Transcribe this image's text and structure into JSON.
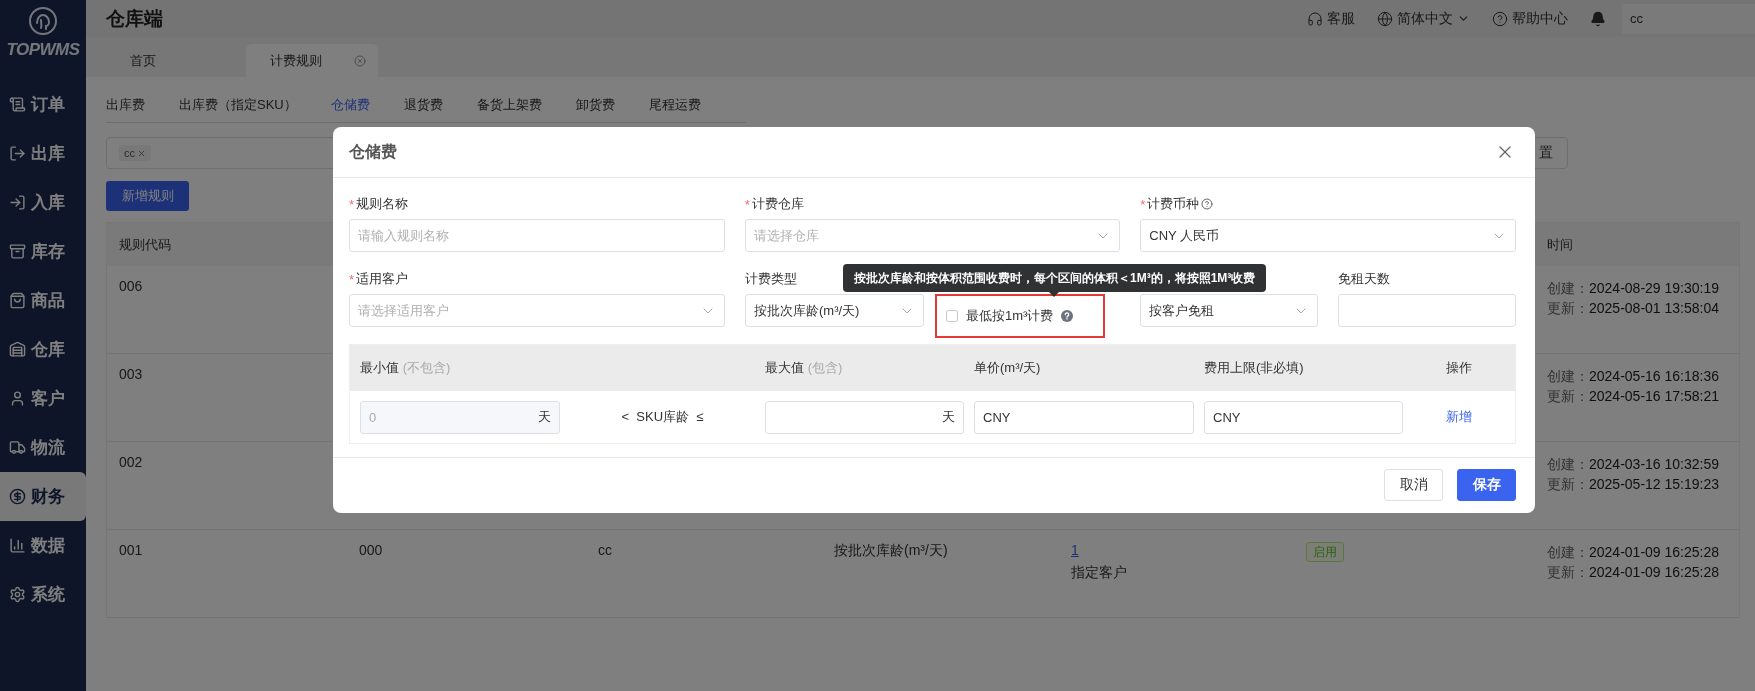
{
  "sidebar": {
    "logo": "TOPWMS",
    "items": [
      {
        "label": "订单",
        "selected": false
      },
      {
        "label": "出库",
        "selected": false
      },
      {
        "label": "入库",
        "selected": false
      },
      {
        "label": "库存",
        "selected": false
      },
      {
        "label": "商品",
        "selected": false
      },
      {
        "label": "仓库",
        "selected": false
      },
      {
        "label": "客户",
        "selected": false
      },
      {
        "label": "物流",
        "selected": false
      },
      {
        "label": "财务",
        "selected": true
      },
      {
        "label": "数据",
        "selected": false
      },
      {
        "label": "系统",
        "selected": false
      }
    ]
  },
  "header": {
    "title": "仓库端",
    "actions": [
      {
        "label": "客服",
        "dropdown": false
      },
      {
        "label": "简体中文",
        "dropdown": true
      },
      {
        "label": "帮助中心",
        "dropdown": false
      }
    ],
    "search": {
      "value": "cc"
    }
  },
  "page_tabs": [
    {
      "label": "首页",
      "selected": false,
      "closable": false
    },
    {
      "label": "计费规则",
      "selected": true,
      "closable": true
    }
  ],
  "fee_tabs": [
    {
      "label": "出库费",
      "selected": false
    },
    {
      "label": "出库费（指定SKU）",
      "selected": false
    },
    {
      "label": "仓储费",
      "selected": true
    },
    {
      "label": "退货费",
      "selected": false
    },
    {
      "label": "备货上架费",
      "selected": false
    },
    {
      "label": "卸货费",
      "selected": false
    },
    {
      "label": "尾程运费",
      "selected": false
    }
  ],
  "filter": {
    "tags": [
      "cc"
    ],
    "reset_button": "置"
  },
  "add_button": "新增规则",
  "table": {
    "header": {
      "column_1": "规则代码",
      "column_7": "时间"
    },
    "rows": [
      {
        "column_1": "006",
        "times": [
          {
            "label": "创建：",
            "value": "2024-08-29 19:30:19"
          },
          {
            "label": "更新：",
            "value": "2025-08-01 13:58:04"
          }
        ]
      },
      {
        "column_1": "003",
        "times": [
          {
            "label": "创建：",
            "value": "2024-05-16 16:18:36"
          },
          {
            "label": "更新：",
            "value": "2024-05-16 17:58:21"
          }
        ]
      },
      {
        "column_1": "002",
        "times": [
          {
            "label": "创建：",
            "value": "2024-03-16 10:32:59"
          },
          {
            "label": "更新：",
            "value": "2025-05-12 15:19:23"
          }
        ]
      },
      {
        "column_1": "001",
        "column_2": "000",
        "column_3": "cc",
        "column_4": "按批次库龄(m³/天)",
        "column_5": {
          "link": "1",
          "text": "指定客户"
        },
        "column_6": {
          "badge": "启用"
        },
        "times": [
          {
            "label": "创建：",
            "value": "2024-01-09 16:25:28"
          },
          {
            "label": "更新：",
            "value": "2024-01-09 16:25:28"
          }
        ]
      }
    ]
  },
  "modal": {
    "open": true,
    "title": "仓储费",
    "form_rows": [
      {
        "fields": [
          {
            "kind": "input",
            "label": "规则名称",
            "required_mark": "*",
            "placeholder": "请输入规则名称"
          },
          {
            "kind": "select",
            "label": "计费仓库",
            "required_mark": "*",
            "placeholder": "请选择仓库"
          },
          {
            "kind": "select",
            "label": "计费币种",
            "required_mark": "*",
            "help": true,
            "value": "CNY 人民币"
          }
        ]
      },
      {
        "fields": [
          {
            "kind": "select",
            "label": "适用客户",
            "required_mark": "*",
            "placeholder": "请选择适用客户"
          },
          {
            "kind": "select",
            "label": "计费类型",
            "value": "按批次库龄(m³/天)"
          },
          {
            "kind": "checkbox",
            "label": "最低按1m³计费",
            "checked": false,
            "help": true,
            "highlighted": true,
            "tooltip": "按批次库龄和按体积范围收费时，每个区间的体积＜1M³的，将按照1M³收费"
          },
          {
            "kind": "select",
            "value": "按客户免租"
          },
          {
            "kind": "input",
            "label": "免租天数"
          }
        ]
      }
    ],
    "range": {
      "columns": [
        {
          "label": "最小值",
          "note": "(不包含)"
        },
        {
          "label": "最大值",
          "note": "(包含)"
        },
        {
          "label": "单价(m³/天)"
        },
        {
          "label": "费用上限(非必填)"
        },
        {
          "label": "操作"
        }
      ],
      "row": {
        "min": {
          "value": "0",
          "unit": "天",
          "disabled": true
        },
        "relation": "<  SKU库龄  ≤",
        "max": {
          "unit": "天"
        },
        "price": {
          "value": "CNY"
        },
        "cap": {
          "value": "CNY"
        },
        "action": "新增"
      }
    },
    "buttons": [
      {
        "label": "取消",
        "primary": false
      },
      {
        "label": "保存",
        "primary": true
      }
    ]
  }
}
